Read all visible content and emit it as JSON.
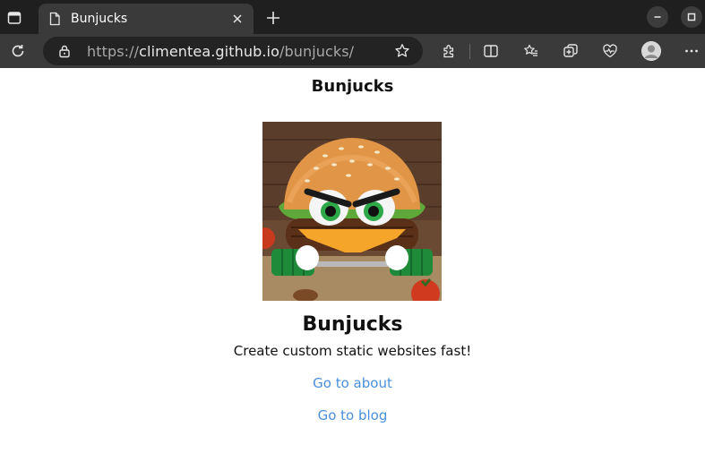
{
  "browser": {
    "tab": {
      "title": "Bunjucks"
    },
    "url": {
      "scheme": "https://",
      "host": "climentea.github.io",
      "path": "/bunjucks/"
    }
  },
  "page": {
    "header": "Bunjucks",
    "hero_image_subject": "angry-burger-mascot",
    "site_title": "Bunjucks",
    "tagline": "Create custom static websites fast!",
    "links": [
      {
        "label": "Go to about"
      },
      {
        "label": "Go to blog"
      }
    ]
  },
  "colors": {
    "tabstrip_bg": "#1f1f1f",
    "toolbar_bg": "#3a3a3a",
    "link": "#4a8fdc"
  }
}
